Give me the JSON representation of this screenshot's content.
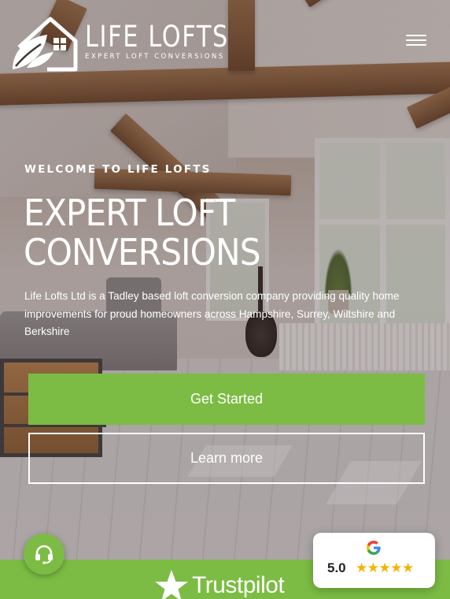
{
  "brand": {
    "name": "LIFE LOFTS",
    "tagline": "EXPERT LOFT CONVERSIONS"
  },
  "hero": {
    "eyebrow": "WELCOME TO LIFE LOFTS",
    "headline": "EXPERT LOFT CONVERSIONS",
    "intro": "Life Lofts Ltd is a Tadley based loft conversion company providing quality home improvements for proud homeowners across Hampshire, Surrey, Wiltshire and Berkshire",
    "primary_cta": "Get Started",
    "secondary_cta": "Learn more"
  },
  "trust": {
    "brand": "Trustpilot"
  },
  "google_rating": {
    "score": "5.0",
    "stars": "★★★★★",
    "rating_value": 5,
    "rating_max": 5
  },
  "icons": {
    "logo": "house-leaf-logo-icon",
    "menu": "hamburger-menu-icon",
    "support": "headset-support-icon",
    "google": "google-g-icon",
    "trustpilot": "trustpilot-star-icon"
  },
  "colors": {
    "accent_green": "#7cbc44",
    "star_gold": "#f5b400",
    "text_white": "#ffffff"
  }
}
